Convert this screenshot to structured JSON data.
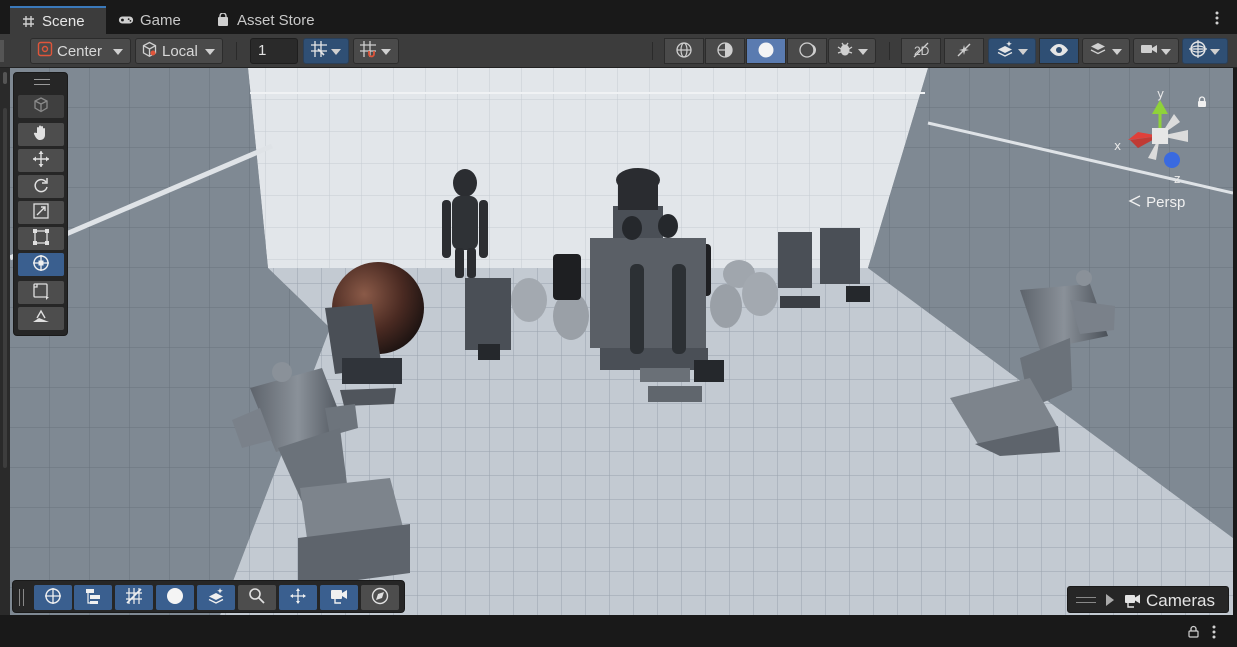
{
  "tabs": [
    {
      "label": "Scene",
      "icon": "grid-hash-icon",
      "active": true
    },
    {
      "label": "Game",
      "icon": "gamepad-icon",
      "active": false
    },
    {
      "label": "Asset Store",
      "icon": "shopping-bag-icon",
      "active": false
    }
  ],
  "toolbar": {
    "pivot_label": "Center",
    "space_label": "Local",
    "grid_size_value": "1"
  },
  "scene": {
    "camera_mode_label": "Persp",
    "axis_labels": {
      "x": "x",
      "y": "y",
      "z": "z"
    }
  },
  "overlays": {
    "cameras_label": "Cameras"
  },
  "colors": {
    "accent": "#3a79bb",
    "toggle_active": "#3a5f8f",
    "axis_x": "#e0403a",
    "axis_y": "#8fd23a",
    "axis_z": "#3a6ae0"
  }
}
